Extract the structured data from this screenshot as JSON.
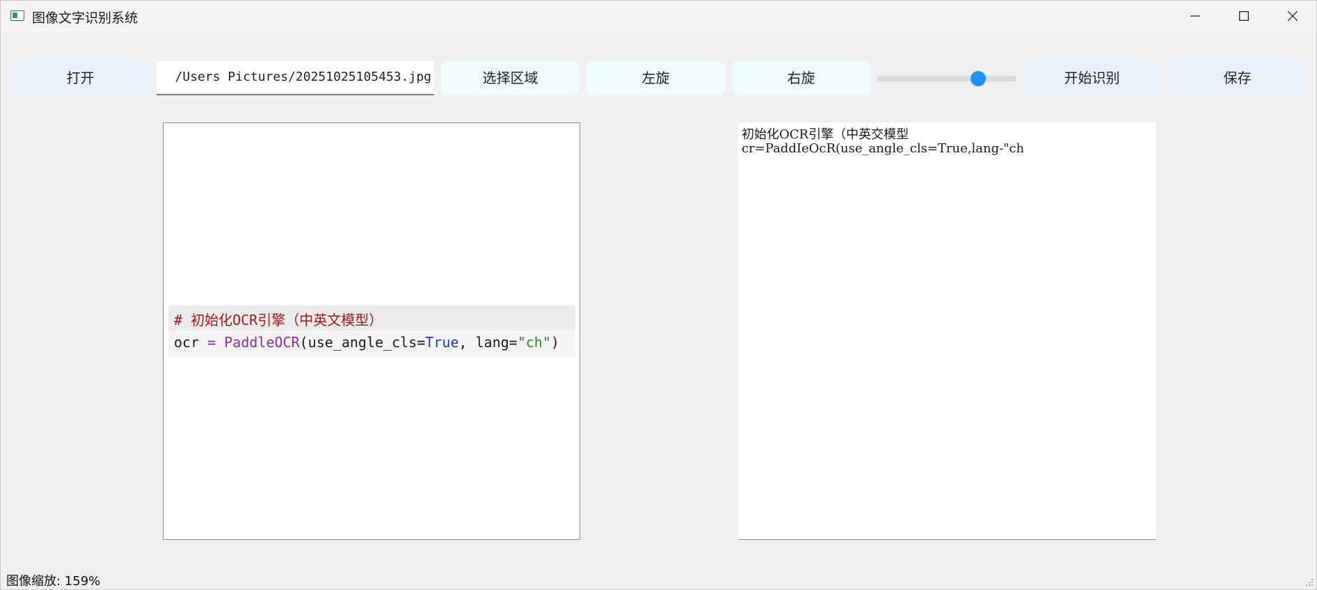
{
  "window": {
    "title": "图像文字识别系统"
  },
  "toolbar": {
    "open_label": "打开",
    "path_value": "/Users        Pictures/20251025105453.jpg",
    "select_region_label": "选择区域",
    "rotate_left_label": "左旋",
    "rotate_right_label": "右旋",
    "zoom_slider_value": 0.75,
    "start_recognition_label": "开始识别",
    "save_label": "保存"
  },
  "image_panel": {
    "code_comment": "# 初始化OCR引擎（中英文模型）",
    "code_line": {
      "var": "ocr",
      "eq": " = ",
      "func": "PaddleOCR",
      "open": "(use_angle_cls=",
      "true_kw": "True",
      "mid": ", lang=",
      "str": "\"ch\"",
      "close": ")"
    }
  },
  "result_panel": {
    "lines": [
      "初始化OCR引擎（中英交模型",
      "cr=PaddIeOcR(use_angle_cls=True,lang-\"ch"
    ]
  },
  "status": {
    "zoom_text": "图像缩放: 159%"
  },
  "colors": {
    "button_blue": "#e8f1fc",
    "button_cyan": "#edfbfb",
    "slider_thumb": "#1e90ff",
    "comment_red": "#a01818"
  }
}
